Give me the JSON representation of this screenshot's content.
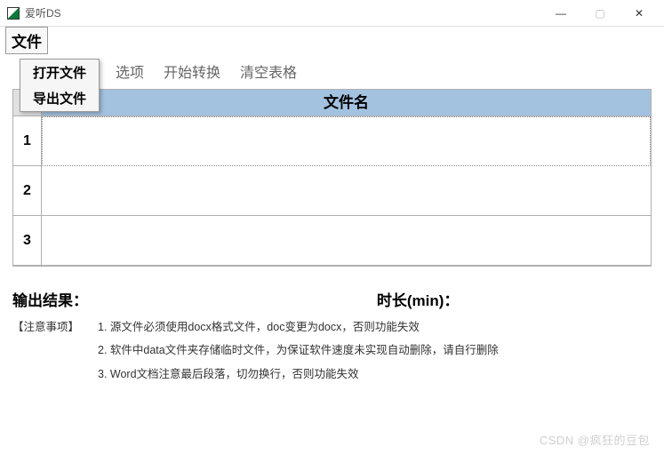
{
  "window": {
    "title": "爱听DS",
    "controls": {
      "min": "—",
      "max": "▢",
      "close": "✕"
    }
  },
  "menubar": {
    "file": "文件"
  },
  "dropdown": {
    "open": "打开文件",
    "export": "导出文件"
  },
  "toolbar": {
    "partial_option": "选项",
    "start": "开始转换",
    "clear": "清空表格"
  },
  "table": {
    "header_filename": "文件名",
    "rows": [
      {
        "num": "1",
        "content": ""
      },
      {
        "num": "2",
        "content": ""
      },
      {
        "num": "3",
        "content": ""
      }
    ]
  },
  "labels": {
    "output": "输出结果：",
    "duration": "时长(min)："
  },
  "notes": {
    "tag": "【注意事项】",
    "n1": "1. 源文件必须使用docx格式文件，doc变更为docx，否则功能失效",
    "n2": "2. 软件中data文件夹存储临时文件，为保证软件速度未实现自动删除，请自行删除",
    "n3": "3. Word文档注意最后段落，切勿换行，否则功能失效"
  },
  "watermark": "CSDN @疯狂的豆包"
}
